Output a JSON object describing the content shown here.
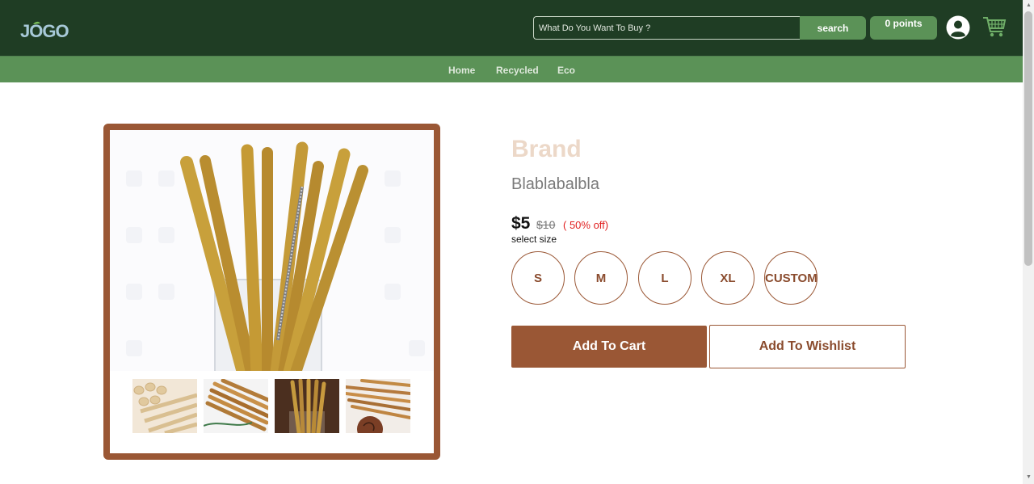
{
  "header": {
    "logo_text": "JOGO",
    "search": {
      "placeholder": "What Do You Want To Buy ?",
      "value": "",
      "button_label": "search"
    },
    "points_label": "0 points",
    "icons": {
      "logo": "jogo-logo",
      "avatar": "user-avatar-icon",
      "cart": "shopping-cart-icon"
    }
  },
  "nav": {
    "items": [
      {
        "label": "Home"
      },
      {
        "label": "Recycled"
      },
      {
        "label": "Eco"
      }
    ]
  },
  "product": {
    "brand": "Brand",
    "name": "Blablabalbla",
    "price": "$5",
    "original_price": "$10",
    "discount": "( 50% off)",
    "size_label": "select size",
    "sizes": [
      {
        "label": "S"
      },
      {
        "label": "M"
      },
      {
        "label": "L"
      },
      {
        "label": "XL"
      },
      {
        "label": "CUSTOM"
      }
    ],
    "add_to_cart_label": "Add To Cart",
    "add_to_wishlist_label": "Add To Wishlist"
  },
  "colors": {
    "header_bg": "#1f3d24",
    "nav_bg": "#5b9257",
    "accent": "#9a5735",
    "brand_text": "#ecd8c8",
    "discount": "#e02020"
  }
}
